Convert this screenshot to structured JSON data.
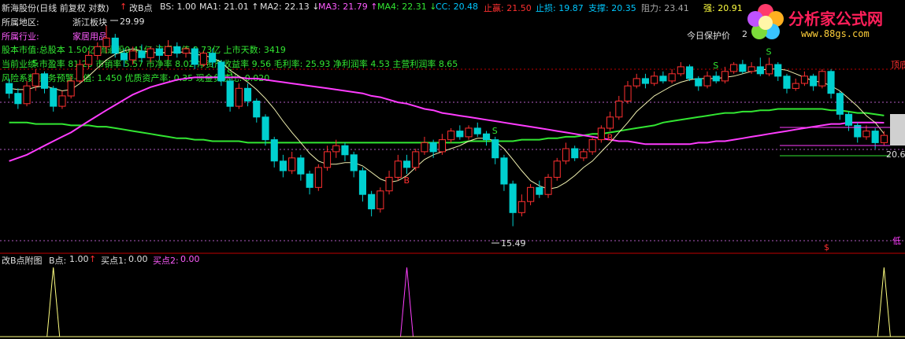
{
  "header": {
    "stock": "新海股份(日线 前复权 对数)",
    "indicator": "改B点",
    "items": [
      {
        "label": "BS:",
        "value": "1.00",
        "color": "#e0e0e0",
        "arrow": ""
      },
      {
        "label": "MA1:",
        "value": "21.01",
        "color": "#e0e0e0",
        "arrow": "↑"
      },
      {
        "label": "MA2:",
        "value": "22.13",
        "color": "#e0e0e0",
        "arrow": "↓"
      },
      {
        "label": "MA3:",
        "value": "21.79",
        "color": "#ff5cff",
        "arrow": "↑"
      },
      {
        "label": "MA4:",
        "value": "22.31",
        "color": "#32e632",
        "arrow": "↓"
      },
      {
        "label": "CC:",
        "value": "20.48",
        "color": "#00c8ff",
        "arrow": ""
      },
      {
        "label": "止赢:",
        "value": "21.50",
        "color": "#ff3030",
        "arrow": ""
      },
      {
        "label": "止损:",
        "value": "19.87",
        "color": "#00c8ff",
        "arrow": ""
      },
      {
        "label": "支撑:",
        "value": "20.35",
        "color": "#00c8ff",
        "arrow": ""
      },
      {
        "label": "阻力:",
        "value": "23.41",
        "color": "#aaaaaa",
        "arrow": ""
      },
      {
        "label": "强:",
        "value": "20.91",
        "color": "#ffff40",
        "arrow": ""
      }
    ]
  },
  "info": {
    "region_label": "所属地区:",
    "region_value": "浙江板块",
    "industry_label": "所属行业:",
    "industry_value": "家居用品",
    "line1": "股本市值:总股本 1.50亿 流通股0.41亿 流通市值 8.73亿 上市天数: 3419",
    "line2": "当前业绩:市盈率 81.23 市销率 5.57 市净率 8.02 净资产收益率 9.56 毛利率: 25.93 净利润率 4.53 主营利润率 8.65",
    "line3": "风险系数:财务预警-Z值: 1.450 优质资产率: 0.35 现金负债比: 0.020",
    "guard_label": "今日保护价",
    "guard_value": "2"
  },
  "annotations": {
    "high_label": "29.99",
    "low_label": "15.49",
    "right_price": "20.6",
    "top_right_tag": "顶底",
    "bottom_right_tag": "低"
  },
  "sub_header": {
    "name": "改B点附图",
    "b_label": "B点:",
    "b_value": "1.00",
    "b_arrow": "↑",
    "s1_label": "买点1:",
    "s1_value": "0.00",
    "s2_label": "买点2:",
    "s2_value": "0.00"
  },
  "logo": {
    "brand": "分析家公式网",
    "url": "www.88gs.com"
  },
  "colors": {
    "up": "#ff3030",
    "down": "#00d0d0",
    "ma1": "#f0f0b0",
    "ma3": "#ff3cff",
    "ma4": "#32e632",
    "sub_b": "#ffff80",
    "sub_s2": "#ff40ff",
    "divider": "#c00000"
  },
  "chart_data": {
    "type": "candlestick",
    "log_scale": true,
    "ylim": [
      15.0,
      31.0
    ],
    "high": 29.99,
    "low": 15.49,
    "candles": [
      [
        24.8,
        24.0,
        25.2,
        23.6
      ],
      [
        24.0,
        23.2,
        24.4,
        22.8
      ],
      [
        23.2,
        24.6,
        25.0,
        23.0
      ],
      [
        24.6,
        25.6,
        26.0,
        24.2
      ],
      [
        25.6,
        24.4,
        25.8,
        24.0
      ],
      [
        24.4,
        23.0,
        24.6,
        22.6
      ],
      [
        23.0,
        23.8,
        24.2,
        22.8
      ],
      [
        23.8,
        25.0,
        25.4,
        23.6
      ],
      [
        25.0,
        26.4,
        26.8,
        24.8
      ],
      [
        26.4,
        27.2,
        27.6,
        26.0
      ],
      [
        27.2,
        28.0,
        28.4,
        26.8
      ],
      [
        28.0,
        28.8,
        29.99,
        27.4
      ],
      [
        28.8,
        27.4,
        29.2,
        27.0
      ],
      [
        27.4,
        26.8,
        27.8,
        26.2
      ],
      [
        26.8,
        27.6,
        28.0,
        26.4
      ],
      [
        27.6,
        27.0,
        28.2,
        26.6
      ],
      [
        27.0,
        27.8,
        28.0,
        26.6
      ],
      [
        27.8,
        27.2,
        28.2,
        26.8
      ],
      [
        27.2,
        28.0,
        28.6,
        26.8
      ],
      [
        28.0,
        27.4,
        28.4,
        27.0
      ],
      [
        27.4,
        27.8,
        28.0,
        27.0
      ],
      [
        27.8,
        26.4,
        28.0,
        26.0
      ],
      [
        26.4,
        27.4,
        27.6,
        26.2
      ],
      [
        27.4,
        26.6,
        27.8,
        26.2
      ],
      [
        26.6,
        25.0,
        26.8,
        24.6
      ],
      [
        25.0,
        23.0,
        25.2,
        22.6
      ],
      [
        23.0,
        24.4,
        24.8,
        22.8
      ],
      [
        24.4,
        23.4,
        24.8,
        23.0
      ],
      [
        23.4,
        22.2,
        23.6,
        21.8
      ],
      [
        22.2,
        20.6,
        22.4,
        20.2
      ],
      [
        20.6,
        19.2,
        20.8,
        18.8
      ],
      [
        19.2,
        18.6,
        19.6,
        18.2
      ],
      [
        18.6,
        19.4,
        19.8,
        18.4
      ],
      [
        19.4,
        18.4,
        19.6,
        18.0
      ],
      [
        18.4,
        17.6,
        18.6,
        17.2
      ],
      [
        17.6,
        18.8,
        19.0,
        17.4
      ],
      [
        18.8,
        19.8,
        20.2,
        18.6
      ],
      [
        19.8,
        20.2,
        20.6,
        19.4
      ],
      [
        20.2,
        19.6,
        20.4,
        19.2
      ],
      [
        19.6,
        18.6,
        19.8,
        18.2
      ],
      [
        18.6,
        17.2,
        18.8,
        16.8
      ],
      [
        17.2,
        16.4,
        17.4,
        16.0
      ],
      [
        16.4,
        17.4,
        17.6,
        16.2
      ],
      [
        17.4,
        18.2,
        18.6,
        17.2
      ],
      [
        18.2,
        19.2,
        19.6,
        18.0
      ],
      [
        19.2,
        18.8,
        19.6,
        18.4
      ],
      [
        18.8,
        19.8,
        20.0,
        18.6
      ],
      [
        19.8,
        20.4,
        20.8,
        19.6
      ],
      [
        20.4,
        19.8,
        20.6,
        19.4
      ],
      [
        19.8,
        20.6,
        21.0,
        19.6
      ],
      [
        20.6,
        21.2,
        21.4,
        20.4
      ],
      [
        21.2,
        20.8,
        21.6,
        20.6
      ],
      [
        20.8,
        21.4,
        21.6,
        20.6
      ],
      [
        21.4,
        21.0,
        21.8,
        20.8
      ],
      [
        21.0,
        20.6,
        21.2,
        20.2
      ],
      [
        20.6,
        19.4,
        20.8,
        19.0
      ],
      [
        19.4,
        17.8,
        19.6,
        17.4
      ],
      [
        17.8,
        16.2,
        18.0,
        15.49
      ],
      [
        16.2,
        16.8,
        17.2,
        16.0
      ],
      [
        16.8,
        17.6,
        17.8,
        16.6
      ],
      [
        17.6,
        17.2,
        18.0,
        17.0
      ],
      [
        17.2,
        18.2,
        18.4,
        17.0
      ],
      [
        18.2,
        19.2,
        19.4,
        18.0
      ],
      [
        19.2,
        20.0,
        20.4,
        19.0
      ],
      [
        20.0,
        19.4,
        20.2,
        19.2
      ],
      [
        19.4,
        19.8,
        20.0,
        19.2
      ],
      [
        19.8,
        20.6,
        20.8,
        19.6
      ],
      [
        20.6,
        21.4,
        21.6,
        20.4
      ],
      [
        21.4,
        22.2,
        22.6,
        21.2
      ],
      [
        22.2,
        23.4,
        23.8,
        22.0
      ],
      [
        23.4,
        24.6,
        25.0,
        23.2
      ],
      [
        24.6,
        25.2,
        25.6,
        24.4
      ],
      [
        25.2,
        24.8,
        25.6,
        24.4
      ],
      [
        24.8,
        25.4,
        25.8,
        24.6
      ],
      [
        25.4,
        25.0,
        25.8,
        24.8
      ],
      [
        25.0,
        25.6,
        26.0,
        24.8
      ],
      [
        25.6,
        26.2,
        26.6,
        25.4
      ],
      [
        26.2,
        25.2,
        26.4,
        25.0
      ],
      [
        25.2,
        24.6,
        25.4,
        24.2
      ],
      [
        24.6,
        25.4,
        25.8,
        24.4
      ],
      [
        25.4,
        25.0,
        25.8,
        24.8
      ],
      [
        25.0,
        25.8,
        26.2,
        24.8
      ],
      [
        25.8,
        26.4,
        26.6,
        25.6
      ],
      [
        26.4,
        25.8,
        26.8,
        25.6
      ],
      [
        25.8,
        26.2,
        26.6,
        25.6
      ],
      [
        26.2,
        25.6,
        27.0,
        25.4
      ],
      [
        25.6,
        26.4,
        27.0,
        25.4
      ],
      [
        26.4,
        25.4,
        26.6,
        25.0
      ],
      [
        25.4,
        24.4,
        25.6,
        24.0
      ],
      [
        24.4,
        24.8,
        25.2,
        24.2
      ],
      [
        24.8,
        25.4,
        25.8,
        24.6
      ],
      [
        25.4,
        24.6,
        25.6,
        24.2
      ],
      [
        24.6,
        25.8,
        26.0,
        24.4
      ],
      [
        25.8,
        24.0,
        26.0,
        23.6
      ],
      [
        24.0,
        22.4,
        24.2,
        22.0
      ],
      [
        22.4,
        21.6,
        22.6,
        21.2
      ],
      [
        21.6,
        20.8,
        21.8,
        20.4
      ],
      [
        20.8,
        21.2,
        21.6,
        20.6
      ],
      [
        21.2,
        20.4,
        21.4,
        20.0
      ],
      [
        20.4,
        20.9,
        21.2,
        20.2
      ]
    ],
    "ma1": [
      24.4,
      24.3,
      24.3,
      24.5,
      24.6,
      24.4,
      24.2,
      24.3,
      24.8,
      25.4,
      26.1,
      26.8,
      27.3,
      27.6,
      27.8,
      27.6,
      27.5,
      27.4,
      27.5,
      27.5,
      27.5,
      27.3,
      27.2,
      27.0,
      26.6,
      25.9,
      25.4,
      24.9,
      24.3,
      23.6,
      22.8,
      21.9,
      21.1,
      20.4,
      19.7,
      19.2,
      19.0,
      19.0,
      19.1,
      19.1,
      18.9,
      18.5,
      18.1,
      17.9,
      18.0,
      18.3,
      18.8,
      19.3,
      19.6,
      19.8,
      20.0,
      20.2,
      20.5,
      20.7,
      20.7,
      20.5,
      20.0,
      19.3,
      18.6,
      18.0,
      17.7,
      17.5,
      17.6,
      17.9,
      18.3,
      18.8,
      19.2,
      19.8,
      20.4,
      21.1,
      21.8,
      22.6,
      23.2,
      23.8,
      24.2,
      24.6,
      24.9,
      25.1,
      25.2,
      25.2,
      25.2,
      25.3,
      25.4,
      25.6,
      25.8,
      25.9,
      26.0,
      26.0,
      25.9,
      25.6,
      25.3,
      25.0,
      24.9,
      24.6,
      24.2,
      23.6,
      23.0,
      22.3,
      21.8,
      21.01
    ],
    "ma3": [
      19.2,
      19.4,
      19.6,
      19.9,
      20.2,
      20.5,
      20.8,
      21.1,
      21.5,
      21.9,
      22.3,
      22.7,
      23.1,
      23.5,
      23.9,
      24.2,
      24.5,
      24.7,
      24.9,
      25.1,
      25.2,
      25.3,
      25.3,
      25.3,
      25.3,
      25.3,
      25.3,
      25.2,
      25.2,
      25.1,
      25.0,
      24.9,
      24.8,
      24.7,
      24.6,
      24.5,
      24.4,
      24.3,
      24.2,
      24.1,
      24.0,
      23.8,
      23.7,
      23.5,
      23.3,
      23.2,
      23.0,
      22.8,
      22.7,
      22.5,
      22.4,
      22.3,
      22.2,
      22.1,
      22.0,
      21.9,
      21.8,
      21.7,
      21.6,
      21.5,
      21.4,
      21.3,
      21.2,
      21.1,
      21.0,
      20.9,
      20.8,
      20.7,
      20.6,
      20.5,
      20.5,
      20.4,
      20.3,
      20.3,
      20.3,
      20.3,
      20.3,
      20.3,
      20.4,
      20.4,
      20.5,
      20.5,
      20.6,
      20.7,
      20.8,
      20.9,
      21.0,
      21.1,
      21.2,
      21.3,
      21.4,
      21.5,
      21.6,
      21.7,
      21.7,
      21.8,
      21.8,
      21.8,
      21.8,
      21.79
    ],
    "ma4": [
      21.8,
      21.8,
      21.8,
      21.7,
      21.7,
      21.7,
      21.7,
      21.6,
      21.6,
      21.6,
      21.5,
      21.5,
      21.4,
      21.3,
      21.2,
      21.1,
      21.0,
      20.9,
      20.8,
      20.7,
      20.7,
      20.6,
      20.6,
      20.5,
      20.5,
      20.5,
      20.5,
      20.4,
      20.4,
      20.4,
      20.4,
      20.4,
      20.4,
      20.4,
      20.4,
      20.4,
      20.4,
      20.4,
      20.4,
      20.4,
      20.4,
      20.4,
      20.4,
      20.4,
      20.4,
      20.4,
      20.4,
      20.4,
      20.4,
      20.4,
      20.4,
      20.4,
      20.5,
      20.5,
      20.5,
      20.5,
      20.5,
      20.5,
      20.6,
      20.6,
      20.6,
      20.7,
      20.7,
      20.8,
      20.8,
      20.9,
      21.0,
      21.0,
      21.1,
      21.2,
      21.3,
      21.4,
      21.5,
      21.6,
      21.8,
      21.9,
      22.0,
      22.1,
      22.2,
      22.3,
      22.4,
      22.5,
      22.5,
      22.6,
      22.6,
      22.7,
      22.7,
      22.8,
      22.8,
      22.8,
      22.8,
      22.8,
      22.8,
      22.7,
      22.7,
      22.6,
      22.5,
      22.5,
      22.4,
      22.31
    ],
    "s_markers": [
      3,
      25,
      55,
      80,
      86
    ],
    "b_markers": [
      45,
      68
    ],
    "sub_spikes": [
      {
        "index": 5,
        "series": "B点",
        "value": 1
      },
      {
        "index": 45,
        "series": "买点2",
        "value": 1
      },
      {
        "index": 99,
        "series": "B点",
        "value": 1
      }
    ]
  }
}
